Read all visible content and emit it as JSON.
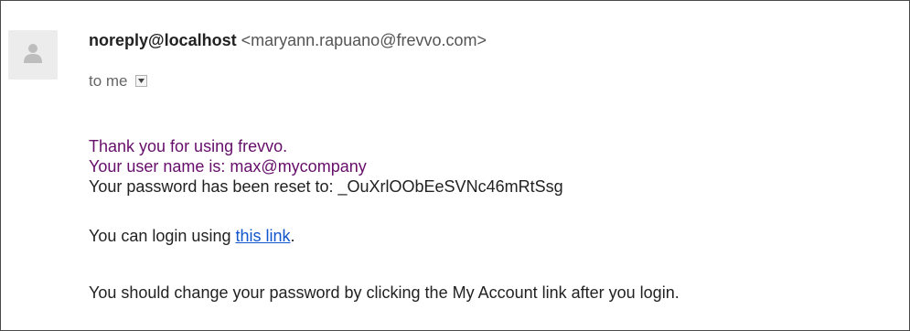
{
  "sender": {
    "name": "noreply@localhost",
    "email": "<maryann.rapuano@frevvo.com>",
    "avatar_icon": "person-icon"
  },
  "recipient": {
    "label": "to me",
    "dropdown_icon": "chevron-down-icon"
  },
  "message": {
    "line_thanks": "Thank you for using frevvo.",
    "line_username": "Your user name is: max@mycompany",
    "line_password": "Your password has been reset to: _OuXrlOObEeSVNc46mRtSsg",
    "login_prefix": "You can login using ",
    "login_link": "this link",
    "login_suffix": ".",
    "line_change": "You should change your password by clicking the My Account link after you login."
  },
  "colors": {
    "purple_text": "#660e6a",
    "link": "#1155cc",
    "body_text": "#222222"
  }
}
